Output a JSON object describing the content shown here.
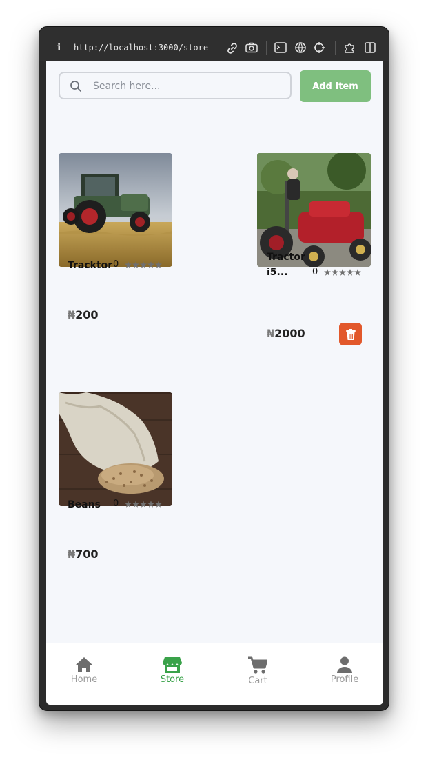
{
  "browser": {
    "info_glyph": "i",
    "url": "http://localhost:3000/store"
  },
  "toolbar_icons": [
    "link-icon",
    "camera-icon",
    "terminal-icon",
    "globe-icon",
    "crosshair-icon",
    "extension-icon",
    "sidebar-icon"
  ],
  "search": {
    "placeholder": "Search here..."
  },
  "add_button": {
    "label": "Add Item"
  },
  "products": [
    {
      "name": "Tracktor",
      "rating_count": "0",
      "currency": "₦",
      "price": "200",
      "stars": 5,
      "image": "green tractor in wheat field"
    },
    {
      "name": "Tractor i5...",
      "rating_count": "0",
      "currency": "₦",
      "price": "2000",
      "stars": 5,
      "image": "man on red tractor",
      "has_delete": true
    },
    {
      "name": "Beans",
      "rating_count": "0",
      "currency": "₦",
      "price": "700",
      "stars": 5,
      "image": "sack of grain"
    }
  ],
  "nav": {
    "home": "Home",
    "store": "Store",
    "cart": "Cart",
    "profile": "Profile",
    "active": "store"
  },
  "colors": {
    "accent_green": "#3aa24a",
    "add_button": "#7fbf7f",
    "delete_button": "#e2582b",
    "background": "#f5f7fb"
  }
}
